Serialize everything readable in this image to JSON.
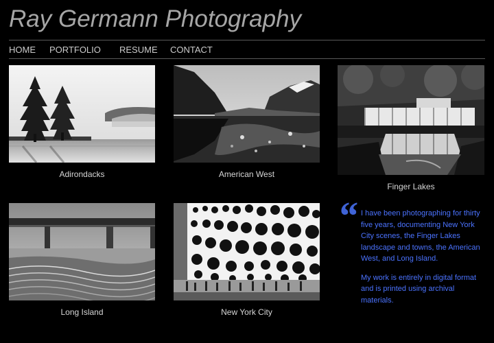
{
  "site": {
    "title": "Ray Germann Photography"
  },
  "nav": {
    "items": [
      {
        "label": "HOME"
      },
      {
        "label": "PORTFOLIO"
      },
      {
        "label": "RESUME"
      },
      {
        "label": "CONTACT"
      }
    ]
  },
  "galleries": [
    {
      "caption": "Adirondacks",
      "icon": "landscape-photo-trees-lake"
    },
    {
      "caption": "American West",
      "icon": "landscape-photo-mountain-reflection"
    },
    {
      "caption": "Finger Lakes",
      "icon": "landscape-photo-waterfall"
    },
    {
      "caption": "Long Island",
      "icon": "landscape-photo-bridge-beach"
    },
    {
      "caption": "New York City",
      "icon": "cityscape-photo-polka-dot-building"
    }
  ],
  "bio": {
    "paragraphs": [
      "I have been photographing for thirty five years, documenting New York City scenes, the Finger Lakes landscape and towns, the American West, and Long Island.",
      "My work is entirely in digital format and is printed using archival materials."
    ]
  },
  "colors": {
    "background": "#000000",
    "title": "#a6a6a6",
    "nav": "#cccccc",
    "accent": "#4b73ff"
  }
}
